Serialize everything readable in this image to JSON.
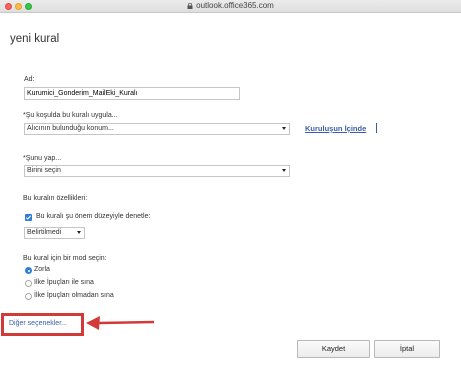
{
  "browser": {
    "url": "outlook.office365.com"
  },
  "page": {
    "title": "yeni kural"
  },
  "form": {
    "name_label": "Ad:",
    "name_value": "Kurumici_Gonderim_MailEki_Kuralı",
    "condition_label": "*Şu koşulda bu kuralı uygula...",
    "condition_select": "Alıcının bulunduğu konum...",
    "condition_link": "Kuruluşun İçinde",
    "action_label": "*Şunu yap...",
    "action_select": "Birini seçin",
    "props_label": "Bu kuralın özellikleri:",
    "importance_check_label": "Bu kuralı şu önem düzeyiyle denetle:",
    "importance_select": "Belirtilmedi",
    "mode_label": "Bu kural için bir mod seçin:",
    "modes": [
      {
        "label": "Zorla",
        "selected": true
      },
      {
        "label": "İlke İpuçları ile sına",
        "selected": false
      },
      {
        "label": "İlke İpuçları olmadan sına",
        "selected": false
      }
    ],
    "more_options": "Diğer seçenekler..."
  },
  "buttons": {
    "save": "Kaydet",
    "cancel": "İptal"
  },
  "colors": {
    "accent": "#2f7fd8",
    "link": "#3b5ea8",
    "highlight": "#d23a3a"
  }
}
